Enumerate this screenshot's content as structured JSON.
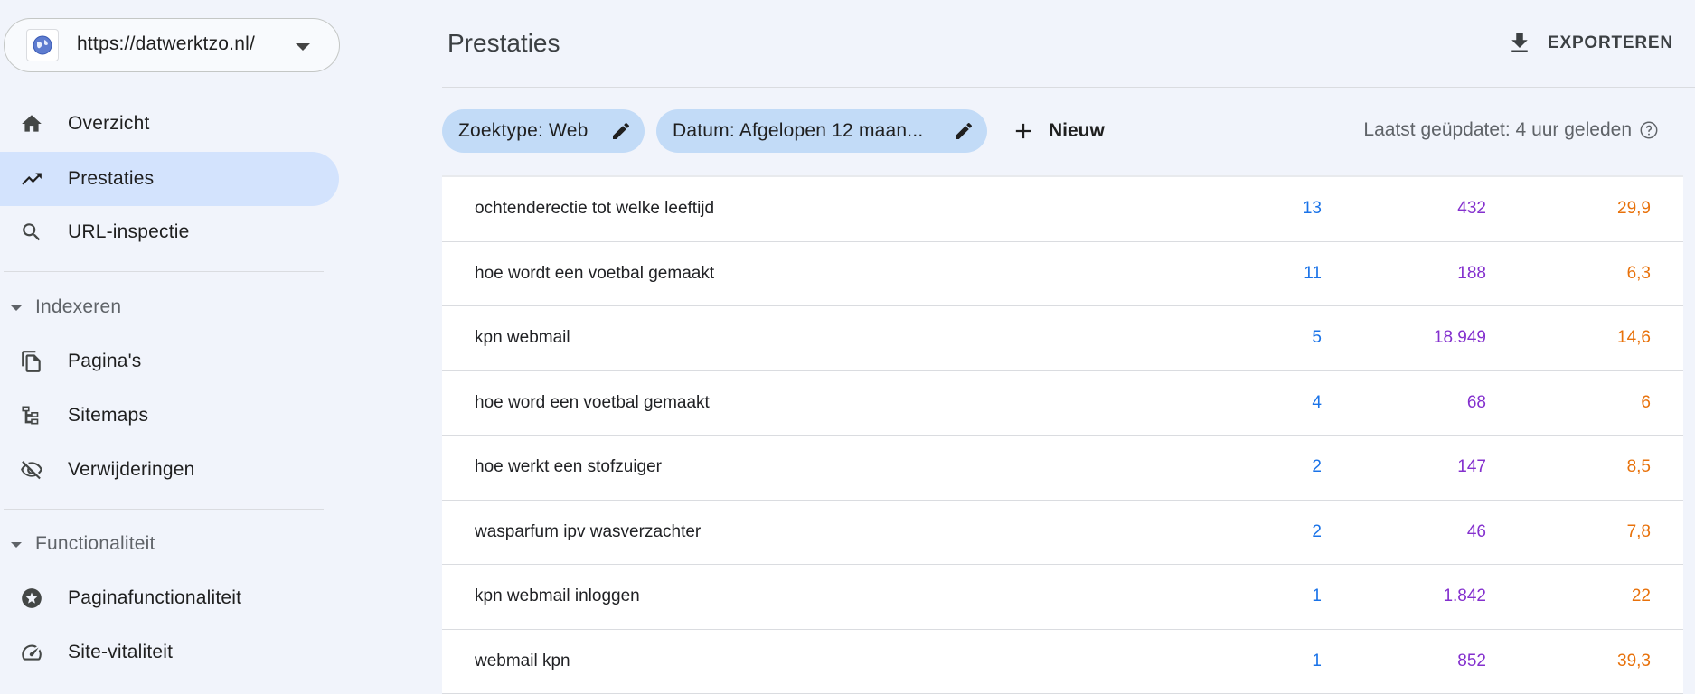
{
  "property": {
    "url": "https://datwerktzo.nl/",
    "icon": "globe-icon"
  },
  "sidebar": {
    "items": [
      {
        "label": "Overzicht",
        "icon": "home-icon"
      },
      {
        "label": "Prestaties",
        "icon": "trending-up-icon",
        "active": true
      },
      {
        "label": "URL-inspectie",
        "icon": "search-icon"
      }
    ],
    "sections": [
      {
        "title": "Indexeren",
        "items": [
          {
            "label": "Pagina's",
            "icon": "pages-icon"
          },
          {
            "label": "Sitemaps",
            "icon": "sitemap-icon"
          },
          {
            "label": "Verwijderingen",
            "icon": "eye-off-icon"
          }
        ]
      },
      {
        "title": "Functionaliteit",
        "items": [
          {
            "label": "Paginafunctionaliteit",
            "icon": "page-experience-icon"
          },
          {
            "label": "Site-vitaliteit",
            "icon": "speedometer-icon"
          }
        ]
      }
    ]
  },
  "header": {
    "title": "Prestaties",
    "export_label": "EXPORTEREN"
  },
  "filters": {
    "chips": [
      {
        "label": "Zoektype: Web"
      },
      {
        "label": "Datum: Afgelopen 12 maan..."
      }
    ],
    "new_label": "Nieuw",
    "updated": "Laatst geüpdatet: 4 uur geleden"
  },
  "table": {
    "rows": [
      {
        "query": "ochtenderectie tot welke leeftijd",
        "clicks": "13",
        "impressions": "432",
        "position": "29,9"
      },
      {
        "query": "hoe wordt een voetbal gemaakt",
        "clicks": "11",
        "impressions": "188",
        "position": "6,3"
      },
      {
        "query": "kpn webmail",
        "clicks": "5",
        "impressions": "18.949",
        "position": "14,6"
      },
      {
        "query": "hoe word een voetbal gemaakt",
        "clicks": "4",
        "impressions": "68",
        "position": "6"
      },
      {
        "query": "hoe werkt een stofzuiger",
        "clicks": "2",
        "impressions": "147",
        "position": "8,5"
      },
      {
        "query": "wasparfum ipv wasverzachter",
        "clicks": "2",
        "impressions": "46",
        "position": "7,8"
      },
      {
        "query": "kpn webmail inloggen",
        "clicks": "1",
        "impressions": "1.842",
        "position": "22"
      },
      {
        "query": "webmail kpn",
        "clicks": "1",
        "impressions": "852",
        "position": "39,3"
      }
    ]
  },
  "colors": {
    "clicks": "#1a73e8",
    "impressions": "#8430ce",
    "position": "#e8710a",
    "active_nav": "#d3e3fd",
    "chip": "#c2dbf7"
  }
}
